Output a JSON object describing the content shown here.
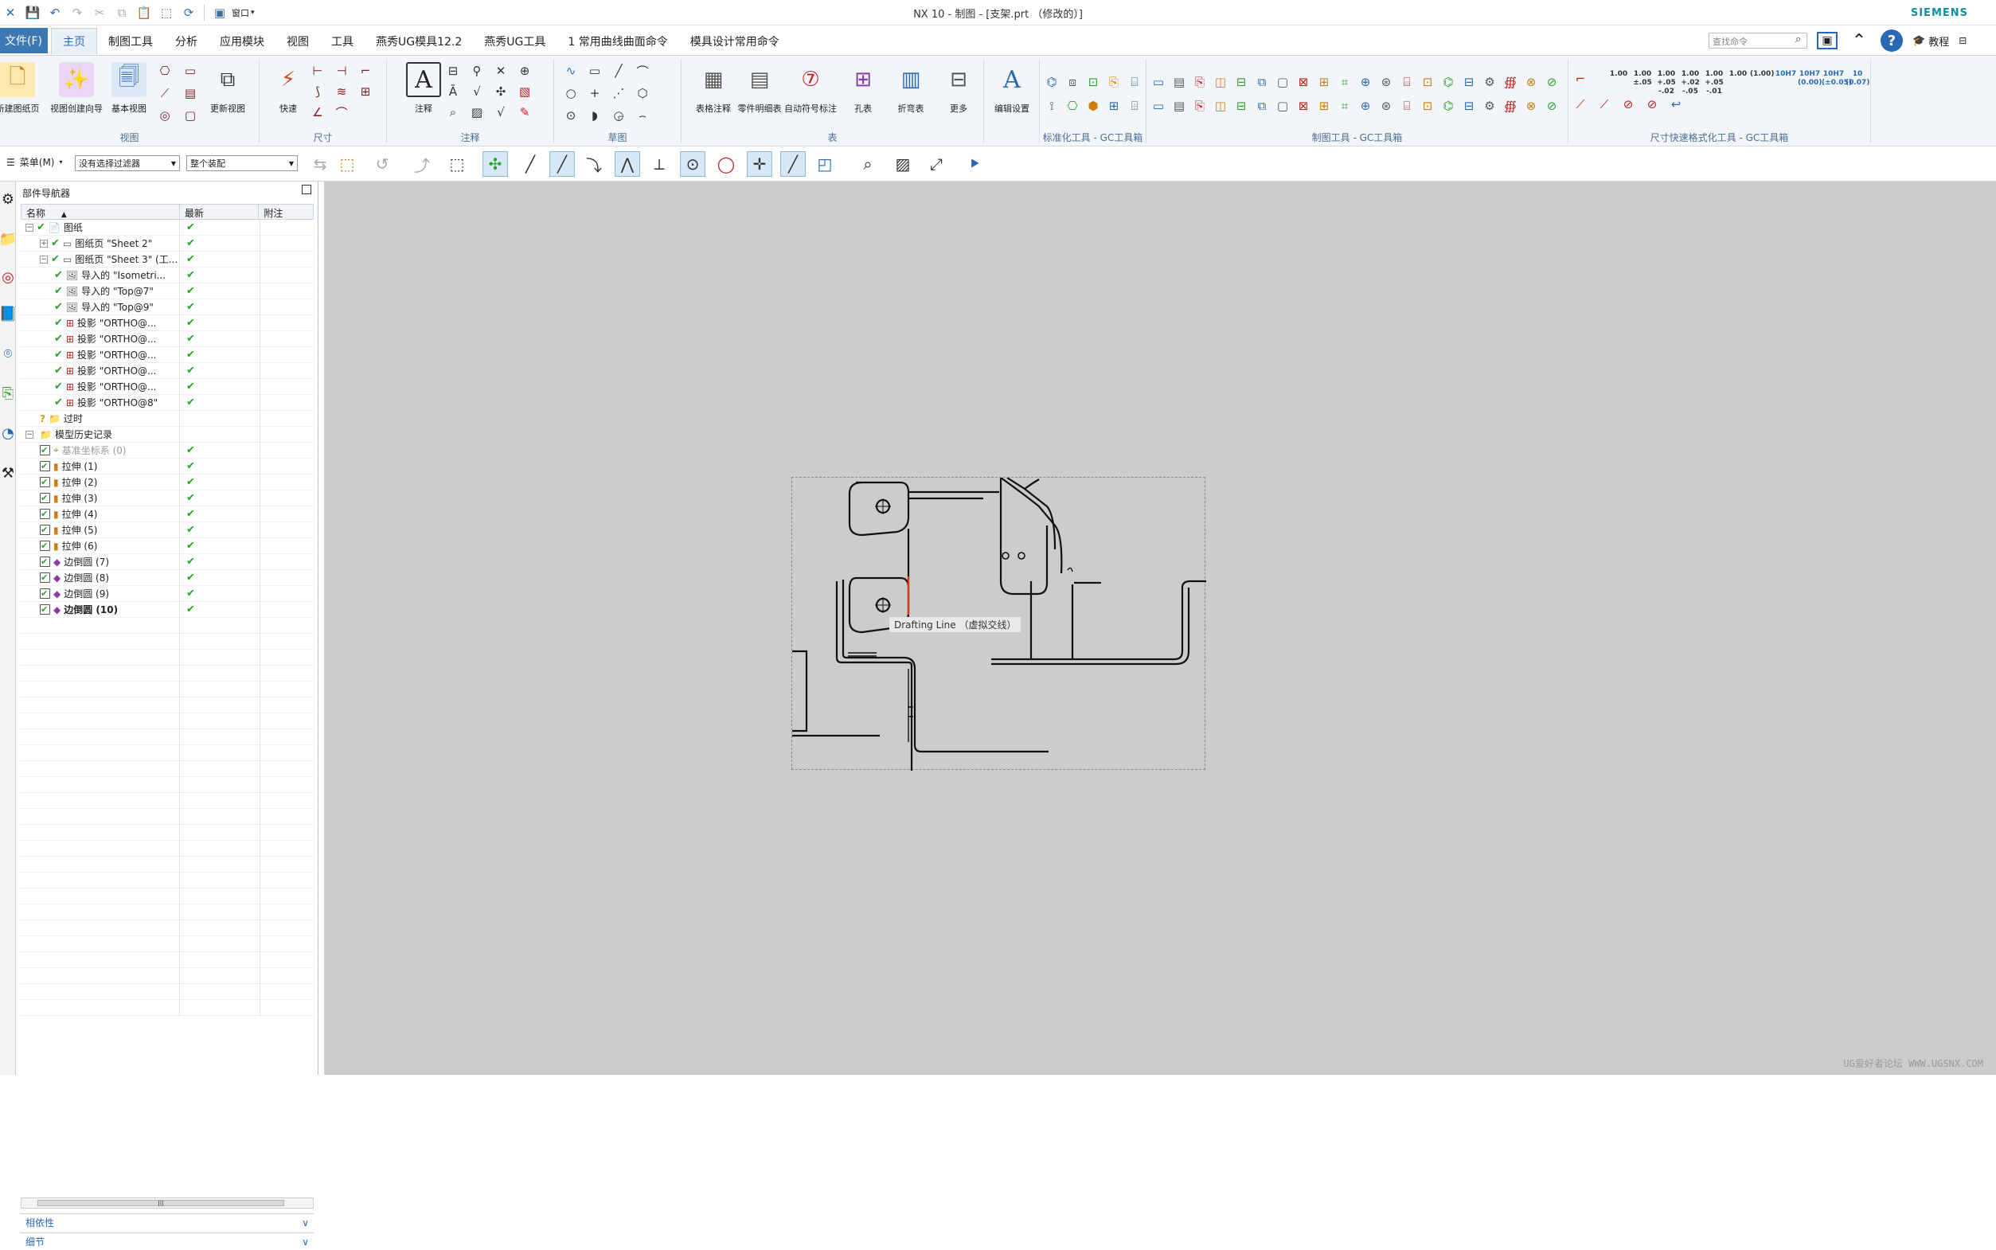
{
  "titlebar": {
    "title": "NX 10 - 制图 - [支架.prt （修改的）]",
    "brand": "SIEMENS",
    "window_menu": "窗口"
  },
  "menubar": {
    "file": "文件(F)",
    "tabs": [
      "主页",
      "制图工具",
      "分析",
      "应用模块",
      "视图",
      "工具",
      "燕秀UG模具12.2",
      "燕秀UG工具",
      "1 常用曲线曲面命令",
      "模具设计常用命令"
    ],
    "search_placeholder": "查找命令",
    "tutorial": "教程"
  },
  "ribbon": {
    "view_buttons": [
      "视图创建向导",
      "基本视图",
      "更新视图"
    ],
    "first_button": "新建图纸页",
    "group_view": "视图",
    "quick": "快速",
    "group_dim": "尺寸",
    "annotation": "注释",
    "group_annotation": "注释",
    "group_sketch": "草图",
    "table_buttons": [
      "表格注释",
      "零件明细表",
      "自动符号标注",
      "孔表",
      "折弯表"
    ],
    "group_table": "表",
    "more": "更多",
    "edit_settings": "编辑设置",
    "group_std": "标准化工具 - GC工具箱",
    "group_draft": "制图工具 - GC工具箱",
    "group_dimfast": "尺寸快速格式化工具 - GC工具箱",
    "tol_labels": [
      "1.00",
      "1.00\n±.05",
      "1.00\n+.05\n-.02",
      "1.00\n+.02\n-.05",
      "1.00\n+.05\n-.01",
      "1.00",
      "(1.00)",
      "10H7",
      "10H7\n(0.00)",
      "10H7\n(±0.05)",
      "10\n(0.07)"
    ]
  },
  "selbar": {
    "menu": "菜单(M)",
    "filter": "没有选择过滤器",
    "scope": "整个装配"
  },
  "navigator": {
    "title": "部件导航器",
    "col_name": "名称",
    "col_latest": "最新",
    "col_note": "附注",
    "rows": [
      {
        "label": "图纸",
        "indent": 0,
        "kind": "root"
      },
      {
        "label": "图纸页 \"Sheet 2\"",
        "indent": 1,
        "kind": "sheet"
      },
      {
        "label": "图纸页 \"Sheet 3\" (工...",
        "indent": 1,
        "kind": "sheet"
      },
      {
        "label": "导入的 \"Isometri...",
        "indent": 2,
        "kind": "view"
      },
      {
        "label": "导入的 \"Top@7\"",
        "indent": 2,
        "kind": "view"
      },
      {
        "label": "导入的 \"Top@9\"",
        "indent": 2,
        "kind": "view"
      },
      {
        "label": "投影 \"ORTHO@...",
        "indent": 2,
        "kind": "proj"
      },
      {
        "label": "投影 \"ORTHO@...",
        "indent": 2,
        "kind": "proj"
      },
      {
        "label": "投影 \"ORTHO@...",
        "indent": 2,
        "kind": "proj"
      },
      {
        "label": "投影 \"ORTHO@...",
        "indent": 2,
        "kind": "proj"
      },
      {
        "label": "投影 \"ORTHO@...",
        "indent": 2,
        "kind": "proj"
      },
      {
        "label": "投影 \"ORTHO@8\"",
        "indent": 2,
        "kind": "proj"
      },
      {
        "label": "过时",
        "indent": 1,
        "kind": "outdated"
      },
      {
        "label": "模型历史记录",
        "indent": 0,
        "kind": "history"
      },
      {
        "label": "基准坐标系 (0)",
        "indent": 1,
        "kind": "datum"
      },
      {
        "label": "拉伸 (1)",
        "indent": 1,
        "kind": "extrude"
      },
      {
        "label": "拉伸 (2)",
        "indent": 1,
        "kind": "extrude"
      },
      {
        "label": "拉伸 (3)",
        "indent": 1,
        "kind": "extrude"
      },
      {
        "label": "拉伸 (4)",
        "indent": 1,
        "kind": "extrude"
      },
      {
        "label": "拉伸 (5)",
        "indent": 1,
        "kind": "extrude"
      },
      {
        "label": "拉伸 (6)",
        "indent": 1,
        "kind": "extrude"
      },
      {
        "label": "边倒圆 (7)",
        "indent": 1,
        "kind": "blend"
      },
      {
        "label": "边倒圆 (8)",
        "indent": 1,
        "kind": "blend"
      },
      {
        "label": "边倒圆 (9)",
        "indent": 1,
        "kind": "blend"
      },
      {
        "label": "边倒圆 (10)",
        "indent": 1,
        "kind": "blend-bold"
      }
    ],
    "dependencies": "相依性",
    "details": "细节"
  },
  "graphics": {
    "tooltip": "Drafting Line （虚拟交线）",
    "watermark": "UG爱好者论坛 WWW.UGSNX.COM"
  }
}
